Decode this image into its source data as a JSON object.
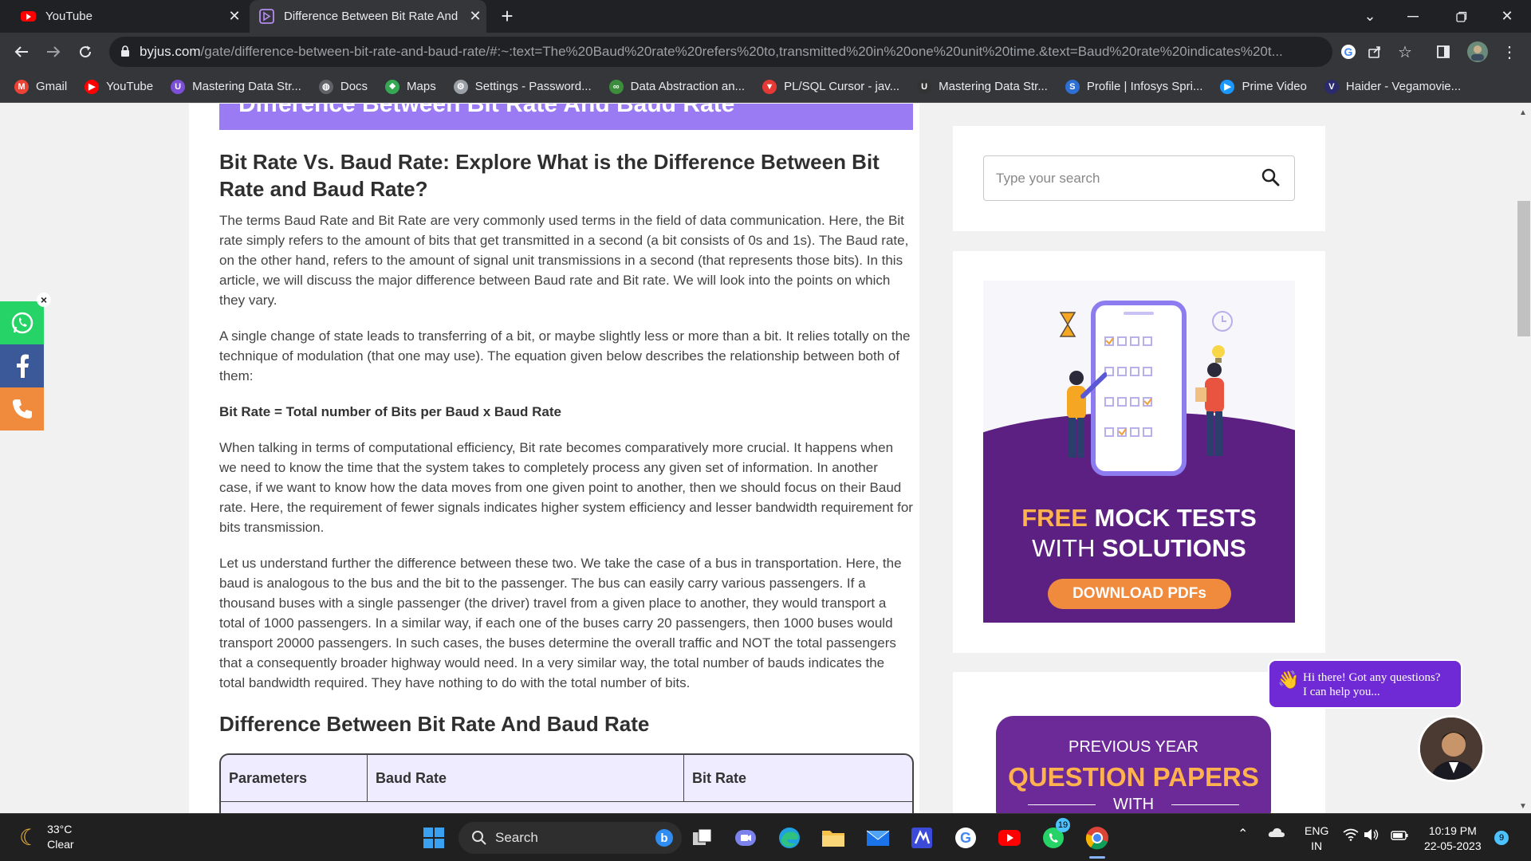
{
  "browser": {
    "tabs": [
      {
        "title": "YouTube",
        "active": false
      },
      {
        "title": "Difference Between Bit Rate And",
        "active": true
      }
    ],
    "url_host": "byjus.com",
    "url_path": "/gate/difference-between-bit-rate-and-baud-rate/#:~:text=The%20Baud%20rate%20refers%20to,transmitted%20in%20one%20unit%20time.&text=Baud%20rate%20indicates%20t...",
    "bookmarks": [
      {
        "label": "Gmail",
        "icon": "gmail-icon",
        "color": "#ea4335"
      },
      {
        "label": "YouTube",
        "icon": "youtube-icon",
        "color": "#ff0000"
      },
      {
        "label": "Mastering Data Str...",
        "icon": "udemy-icon",
        "color": "#7b4fd6"
      },
      {
        "label": "Docs",
        "icon": "globe-icon",
        "color": "#5f6368"
      },
      {
        "label": "Maps",
        "icon": "maps-icon",
        "color": "#34a853"
      },
      {
        "label": "Settings - Password...",
        "icon": "gear-icon",
        "color": "#9aa0a6"
      },
      {
        "label": "Data Abstraction an...",
        "icon": "link-icon",
        "color": "#3c8d3c"
      },
      {
        "label": "PL/SQL Cursor - jav...",
        "icon": "javatpoint-icon",
        "color": "#e53935"
      },
      {
        "label": "Mastering Data Str...",
        "icon": "udemy-icon",
        "color": "#333333"
      },
      {
        "label": "Profile | Infosys Spri...",
        "icon": "infosys-icon",
        "color": "#2d6fd3"
      },
      {
        "label": "Prime Video",
        "icon": "prime-video-icon",
        "color": "#1a98ff"
      },
      {
        "label": "Haider - Vegamovie...",
        "icon": "vegamovies-icon",
        "color": "#2a2a6c"
      }
    ]
  },
  "page": {
    "banner_title": "Difference Between Bit Rate And Baud Rate",
    "heading": "Bit Rate Vs. Baud Rate: Explore What is the Difference Between Bit Rate and Baud Rate?",
    "paragraphs": [
      "The terms Baud Rate and Bit Rate are very commonly used terms in the field of data communication. Here, the Bit rate simply refers to the amount of bits that get transmitted in a second (a bit consists of 0s and 1s). The Baud rate, on the other hand, refers to the amount of signal unit transmissions in a second (that represents those bits). In this article, we will discuss the major difference between Baud rate and Bit rate. We will look into the points on which they vary.",
      "A single change of state leads to transferring of a bit, or maybe slightly less or more than a bit. It relies totally on the technique of modulation (that one may use). The equation given below describes the relationship between both of them:",
      "When talking in terms of computational efficiency, Bit rate becomes comparatively more crucial. It happens when we need to know the time that the system takes to completely process any given set of information. In another case, if we want to know how the data moves from one given point to another, then we should focus on their Baud rate. Here, the requirement of fewer signals indicates higher system efficiency and lesser bandwidth requirement for bits transmission.",
      "Let us understand further the difference between these two. We take the case of a bus in transportation. Here, the baud is analogous to the bus and the bit to the passenger. The bus can easily carry various passengers. If a thousand buses with a single passenger (the driver) travel from a given place to another, they would transport a total of 1000 passengers. In a similar way, if each one of the buses carry 20 passengers, then 1000 buses would transport 20000 passengers. In such cases, the buses determine the overall traffic and NOT the total passengers that a consequently broader highway would need. In a very similar way, the total number of bauds indicates the total bandwidth required. They have nothing to do with the total number of bits."
    ],
    "formula": "Bit Rate = Total number of Bits per Baud x Baud Rate",
    "subheading": "Difference Between Bit Rate And Baud Rate",
    "table_headers": [
      "Parameters",
      "Baud Rate",
      "Bit Rate"
    ]
  },
  "sidebar": {
    "search_placeholder": "Type your search",
    "promo": {
      "free": "FREE",
      "mock_tests": "MOCK TESTS",
      "with": "WITH",
      "solutions": "SOLUTIONS",
      "button": "DOWNLOAD PDFs"
    },
    "pyq": {
      "line1": "PREVIOUS YEAR",
      "line2": "QUESTION PAPERS",
      "line3": "WITH"
    }
  },
  "chat": {
    "line1": "Hi there! Got any questions?",
    "line2": "I can help you..."
  },
  "social": [
    {
      "icon": "whatsapp-icon",
      "color": "#25d366"
    },
    {
      "icon": "facebook-icon",
      "color": "#3b5998"
    },
    {
      "icon": "phone-icon",
      "color": "#f08a3d"
    }
  ],
  "taskbar": {
    "temperature": "33°C",
    "condition": "Clear",
    "search_label": "Search",
    "whatsapp_badge": "19",
    "language": "ENG",
    "region": "IN",
    "time": "10:19 PM",
    "date": "22-05-2023",
    "notification_count": "9"
  }
}
